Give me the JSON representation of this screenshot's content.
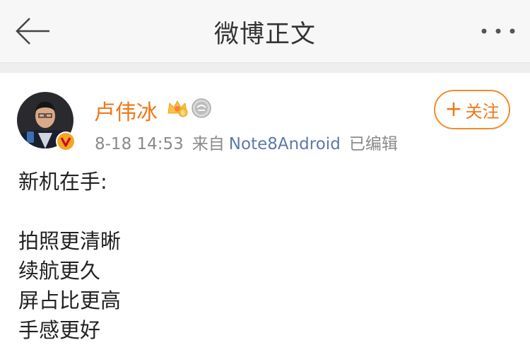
{
  "header": {
    "title": "微博正文",
    "back_icon": "back-arrow-icon",
    "more_icon": "more-dots-icon"
  },
  "post": {
    "author": {
      "name": "卢伟冰",
      "verified_icon": "verified-v-icon",
      "badges": [
        "crown-level-icon",
        "medal-icon"
      ]
    },
    "meta": {
      "time": "8-18 14:53",
      "from_label": "来自",
      "source": "Note8Android",
      "edited": "已编辑"
    },
    "follow_label": "关注",
    "content": {
      "intro": "新机在手:",
      "points": [
        "拍照更清晰",
        "续航更久",
        "屏占比更高",
        "手感更好"
      ]
    }
  },
  "colors": {
    "accent": "#ee7718",
    "source_link": "#5b7aa8",
    "meta_gray": "#8a8a8a"
  }
}
